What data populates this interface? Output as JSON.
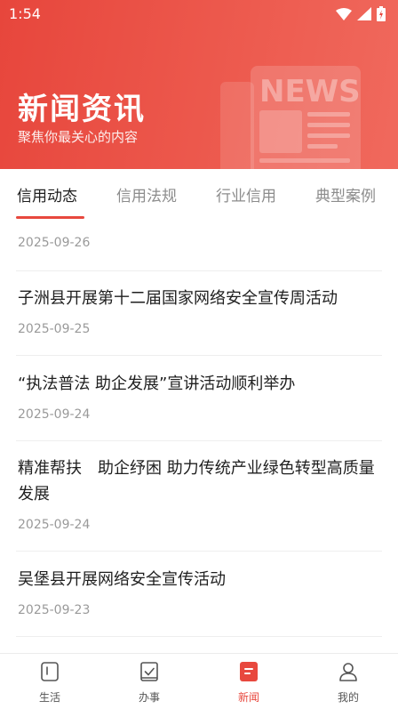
{
  "status_bar": {
    "time": "1:54",
    "icons": [
      "wifi-icon",
      "signal-icon",
      "battery-icon"
    ]
  },
  "header": {
    "title": "新闻资讯",
    "subtitle": "聚焦你最关心的内容",
    "illustration_text": "NEWS"
  },
  "tabs": [
    {
      "label": "信用动态",
      "active": true
    },
    {
      "label": "信用法规",
      "active": false
    },
    {
      "label": "行业信用",
      "active": false
    },
    {
      "label": "典型案例",
      "active": false
    }
  ],
  "articles": [
    {
      "title": "",
      "date": "2025-09-26"
    },
    {
      "title": "子洲县开展第十二届国家网络安全宣传周活动",
      "date": "2025-09-25"
    },
    {
      "title": "“执法普法 助企发展”宣讲活动顺利举办",
      "date": "2025-09-24"
    },
    {
      "title": "精准帮扶　助企纾困 助力传统产业绿色转型高质量发展",
      "date": "2025-09-24"
    },
    {
      "title": "吴堡县开展网络安全宣传活动",
      "date": "2025-09-23"
    }
  ],
  "bottom_nav": [
    {
      "label": "生活",
      "icon": "life-icon",
      "active": false
    },
    {
      "label": "办事",
      "icon": "service-icon",
      "active": false
    },
    {
      "label": "新闻",
      "icon": "news-icon",
      "active": true
    },
    {
      "label": "我的",
      "icon": "profile-icon",
      "active": false
    }
  ],
  "colors": {
    "accent": "#e8483e",
    "header_start": "#e7463c",
    "header_end": "#f0695d"
  }
}
